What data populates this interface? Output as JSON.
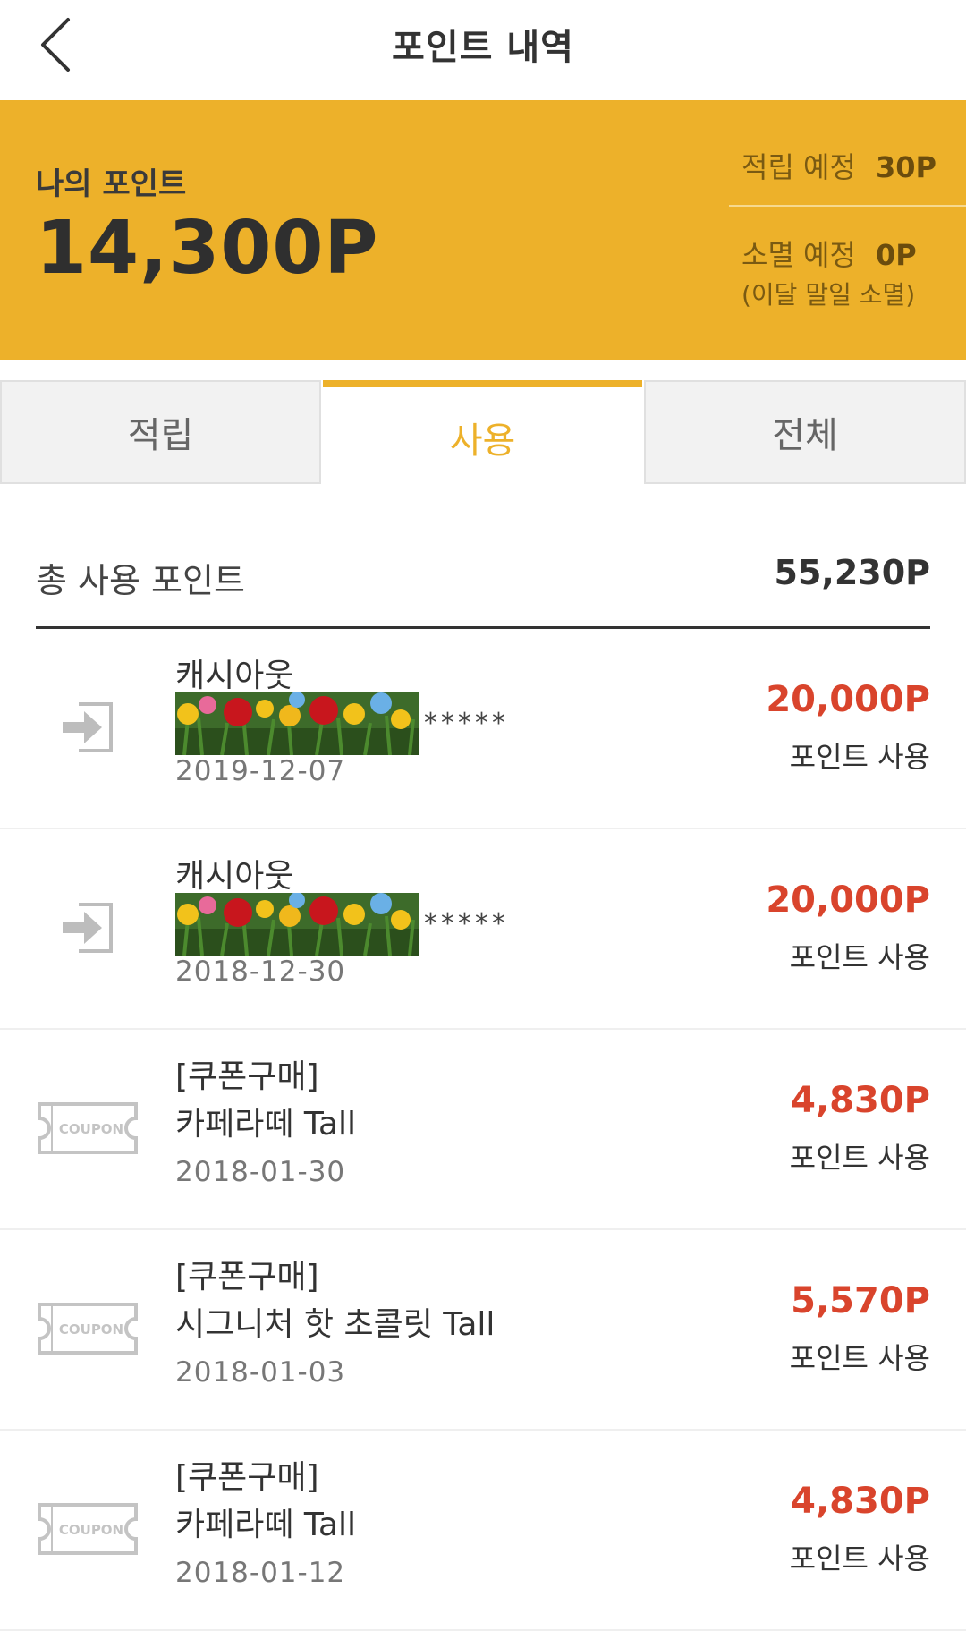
{
  "header": {
    "title": "포인트 내역",
    "back_icon": "chevron-left-icon"
  },
  "summary": {
    "my_point_label": "나의 포인트",
    "my_point_value": "14,300P",
    "accrue_label": "적립 예정",
    "accrue_value": "30P",
    "expire_label": "소멸 예정",
    "expire_value": "0P",
    "expire_note": "(이달 말일 소멸)",
    "background_color": "#EDB12A"
  },
  "tabs": [
    {
      "label": "적립",
      "active": false
    },
    {
      "label": "사용",
      "active": true
    },
    {
      "label": "전체",
      "active": false
    }
  ],
  "total": {
    "label": "총 사용 포인트",
    "value": "55,230P"
  },
  "items": [
    {
      "icon": "cashout-arrow-icon",
      "line1": "캐시아웃",
      "line2_masked": "*****",
      "date": "2019-12-07",
      "amount": "20,000P",
      "type": "포인트 사용"
    },
    {
      "icon": "cashout-arrow-icon",
      "line1": "캐시아웃",
      "line2_masked": "*****",
      "date": "2018-12-30",
      "amount": "20,000P",
      "type": "포인트 사용"
    },
    {
      "icon": "coupon-icon",
      "icon_text": "COUPON",
      "line1": "[쿠폰구매]",
      "line2": "카페라떼 Tall",
      "date": "2018-01-30",
      "amount": "4,830P",
      "type": "포인트 사용"
    },
    {
      "icon": "coupon-icon",
      "icon_text": "COUPON",
      "line1": "[쿠폰구매]",
      "line2": "시그니처 핫 초콜릿 Tall",
      "date": "2018-01-03",
      "amount": "5,570P",
      "type": "포인트 사용"
    },
    {
      "icon": "coupon-icon",
      "icon_text": "COUPON",
      "line1": "[쿠폰구매]",
      "line2": "카페라떼 Tall",
      "date": "2018-01-12",
      "amount": "4,830P",
      "type": "포인트 사용"
    }
  ],
  "colors": {
    "accent": "#EDB12A",
    "amount_red": "#D9442C"
  }
}
